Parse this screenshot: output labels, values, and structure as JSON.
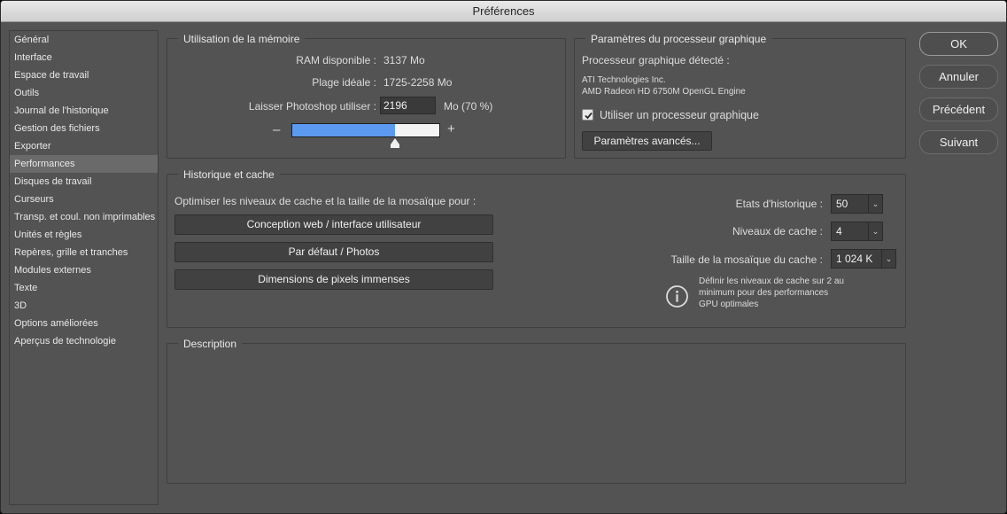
{
  "window": {
    "title": "Préférences"
  },
  "sidebar": {
    "items": [
      {
        "label": "Général"
      },
      {
        "label": "Interface"
      },
      {
        "label": "Espace de travail"
      },
      {
        "label": "Outils"
      },
      {
        "label": "Journal de l'historique"
      },
      {
        "label": "Gestion des fichiers"
      },
      {
        "label": "Exporter"
      },
      {
        "label": "Performances",
        "active": true
      },
      {
        "label": "Disques de travail"
      },
      {
        "label": "Curseurs"
      },
      {
        "label": "Transp. et coul. non imprimables"
      },
      {
        "label": "Unités et règles"
      },
      {
        "label": "Repères, grille et tranches"
      },
      {
        "label": "Modules externes"
      },
      {
        "label": "Texte"
      },
      {
        "label": "3D"
      },
      {
        "label": "Options améliorées"
      },
      {
        "label": "Aperçus de technologie"
      }
    ]
  },
  "memory": {
    "title": "Utilisation de la mémoire",
    "ram_label": "RAM disponible :",
    "ram_value": "3137 Mo",
    "range_label": "Plage idéale :",
    "range_value": "1725-2258 Mo",
    "use_label": "Laisser Photoshop utiliser :",
    "use_value": "2196",
    "use_unit": "Mo (70 %)",
    "minus": "–",
    "plus": "+",
    "slider_fraction": 0.7
  },
  "gpu": {
    "title": "Paramètres du processeur graphique",
    "detected_label": "Processeur graphique détecté :",
    "vendor": "ATI Technologies Inc.",
    "model": "AMD Radeon HD 6750M OpenGL Engine",
    "use_gpu_label": "Utiliser un processeur graphique",
    "use_gpu_checked": true,
    "advanced_button": "Paramètres avancés..."
  },
  "cache": {
    "title": "Historique et cache",
    "optimize_label": "Optimiser les niveaux de cache et la taille de la mosaïque pour :",
    "buttons": {
      "web": "Conception web / interface utilisateur",
      "default": "Par défaut / Photos",
      "huge": "Dimensions de pixels immenses"
    },
    "history_label": "Etats d'historique :",
    "history_value": "50",
    "levels_label": "Niveaux de cache :",
    "levels_value": "4",
    "tile_label": "Taille de la mosaïque du cache :",
    "tile_value": "1 024 K",
    "info_line1": "Définir les niveaux de cache sur 2 au",
    "info_line2": "minimum pour des performances",
    "info_line3": "GPU optimales"
  },
  "description": {
    "title": "Description"
  },
  "actions": {
    "ok": "OK",
    "cancel": "Annuler",
    "previous": "Précédent",
    "next": "Suivant"
  }
}
